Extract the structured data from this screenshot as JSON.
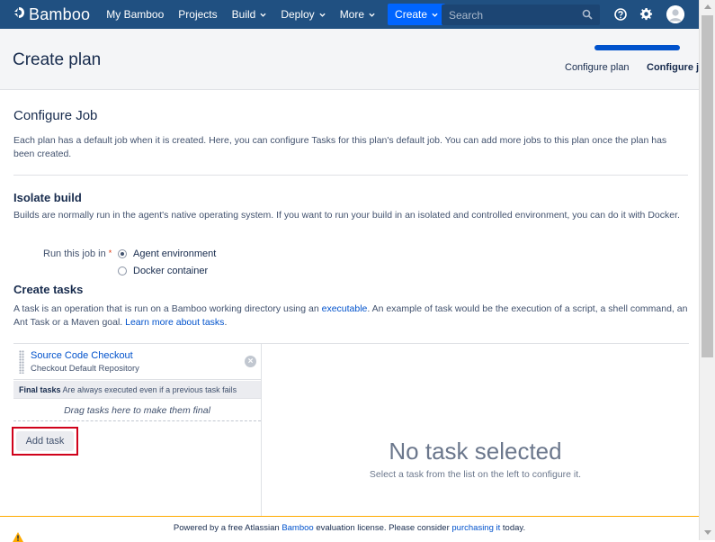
{
  "nav": {
    "logo_text": "Bamboo",
    "links": [
      {
        "label": "My Bamboo"
      },
      {
        "label": "Projects"
      },
      {
        "label": "Build"
      },
      {
        "label": "Deploy"
      },
      {
        "label": "More"
      }
    ],
    "create_label": "Create",
    "search_placeholder": "Search"
  },
  "header": {
    "title": "Create plan",
    "steps": [
      "Configure plan",
      "Configure job"
    ],
    "progress": 1.0
  },
  "configure_job": {
    "title": "Configure Job",
    "description": "Each plan has a default job when it is created. Here, you can configure Tasks for this plan's default job. You can add more jobs to this plan once the plan has been created."
  },
  "isolate": {
    "title": "Isolate build",
    "description": "Builds are normally run in the agent's native operating system. If you want to run your build in an isolated and controlled environment, you can do it with Docker.",
    "field_label": "Run this job in",
    "required_mark": "*",
    "options": [
      {
        "label": "Agent environment",
        "selected": true
      },
      {
        "label": "Docker container",
        "selected": false
      }
    ]
  },
  "create_tasks": {
    "title": "Create tasks",
    "desc_1": "A task is an operation that is run on a Bamboo working directory using an ",
    "desc_link_1": "executable",
    "desc_2": ". An example of task would be the execution of a script, a shell command, an Ant Task or a Maven goal. ",
    "desc_link_2": "Learn more about tasks",
    "desc_3": "."
  },
  "tasks": {
    "items": [
      {
        "name": "Source Code Checkout",
        "description": "Checkout Default Repository"
      }
    ],
    "final_label": "Final tasks",
    "final_desc": "Are always executed even if a previous task fails",
    "drag_hint": "Drag tasks here to make them final",
    "add_task_label": "Add task",
    "empty_title": "No task selected",
    "empty_subtitle": "Select a task from the list on the left to configure it."
  },
  "footer": {
    "text_1": "Powered by a free Atlassian ",
    "link_1": "Bamboo",
    "text_2": " evaluation license. Please consider ",
    "link_2": "purchasing it",
    "text_3": " today."
  },
  "colors": {
    "nav_bg": "#205081",
    "accent": "#0052cc",
    "highlight": "#d0021b",
    "footer_border": "#ffab00"
  }
}
